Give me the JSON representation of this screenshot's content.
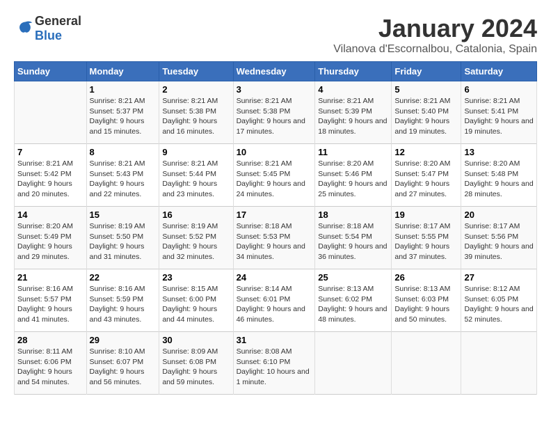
{
  "header": {
    "title": "January 2024",
    "subtitle": "Vilanova d'Escornalbou, Catalonia, Spain"
  },
  "logo": {
    "general": "General",
    "blue": "Blue"
  },
  "columns": [
    "Sunday",
    "Monday",
    "Tuesday",
    "Wednesday",
    "Thursday",
    "Friday",
    "Saturday"
  ],
  "weeks": [
    [
      {
        "day": "",
        "sunrise": "",
        "sunset": "",
        "daylight": ""
      },
      {
        "day": "1",
        "sunrise": "Sunrise: 8:21 AM",
        "sunset": "Sunset: 5:37 PM",
        "daylight": "Daylight: 9 hours and 15 minutes."
      },
      {
        "day": "2",
        "sunrise": "Sunrise: 8:21 AM",
        "sunset": "Sunset: 5:38 PM",
        "daylight": "Daylight: 9 hours and 16 minutes."
      },
      {
        "day": "3",
        "sunrise": "Sunrise: 8:21 AM",
        "sunset": "Sunset: 5:38 PM",
        "daylight": "Daylight: 9 hours and 17 minutes."
      },
      {
        "day": "4",
        "sunrise": "Sunrise: 8:21 AM",
        "sunset": "Sunset: 5:39 PM",
        "daylight": "Daylight: 9 hours and 18 minutes."
      },
      {
        "day": "5",
        "sunrise": "Sunrise: 8:21 AM",
        "sunset": "Sunset: 5:40 PM",
        "daylight": "Daylight: 9 hours and 19 minutes."
      },
      {
        "day": "6",
        "sunrise": "Sunrise: 8:21 AM",
        "sunset": "Sunset: 5:41 PM",
        "daylight": "Daylight: 9 hours and 19 minutes."
      }
    ],
    [
      {
        "day": "7",
        "sunrise": "Sunrise: 8:21 AM",
        "sunset": "Sunset: 5:42 PM",
        "daylight": "Daylight: 9 hours and 20 minutes."
      },
      {
        "day": "8",
        "sunrise": "Sunrise: 8:21 AM",
        "sunset": "Sunset: 5:43 PM",
        "daylight": "Daylight: 9 hours and 22 minutes."
      },
      {
        "day": "9",
        "sunrise": "Sunrise: 8:21 AM",
        "sunset": "Sunset: 5:44 PM",
        "daylight": "Daylight: 9 hours and 23 minutes."
      },
      {
        "day": "10",
        "sunrise": "Sunrise: 8:21 AM",
        "sunset": "Sunset: 5:45 PM",
        "daylight": "Daylight: 9 hours and 24 minutes."
      },
      {
        "day": "11",
        "sunrise": "Sunrise: 8:20 AM",
        "sunset": "Sunset: 5:46 PM",
        "daylight": "Daylight: 9 hours and 25 minutes."
      },
      {
        "day": "12",
        "sunrise": "Sunrise: 8:20 AM",
        "sunset": "Sunset: 5:47 PM",
        "daylight": "Daylight: 9 hours and 27 minutes."
      },
      {
        "day": "13",
        "sunrise": "Sunrise: 8:20 AM",
        "sunset": "Sunset: 5:48 PM",
        "daylight": "Daylight: 9 hours and 28 minutes."
      }
    ],
    [
      {
        "day": "14",
        "sunrise": "Sunrise: 8:20 AM",
        "sunset": "Sunset: 5:49 PM",
        "daylight": "Daylight: 9 hours and 29 minutes."
      },
      {
        "day": "15",
        "sunrise": "Sunrise: 8:19 AM",
        "sunset": "Sunset: 5:50 PM",
        "daylight": "Daylight: 9 hours and 31 minutes."
      },
      {
        "day": "16",
        "sunrise": "Sunrise: 8:19 AM",
        "sunset": "Sunset: 5:52 PM",
        "daylight": "Daylight: 9 hours and 32 minutes."
      },
      {
        "day": "17",
        "sunrise": "Sunrise: 8:18 AM",
        "sunset": "Sunset: 5:53 PM",
        "daylight": "Daylight: 9 hours and 34 minutes."
      },
      {
        "day": "18",
        "sunrise": "Sunrise: 8:18 AM",
        "sunset": "Sunset: 5:54 PM",
        "daylight": "Daylight: 9 hours and 36 minutes."
      },
      {
        "day": "19",
        "sunrise": "Sunrise: 8:17 AM",
        "sunset": "Sunset: 5:55 PM",
        "daylight": "Daylight: 9 hours and 37 minutes."
      },
      {
        "day": "20",
        "sunrise": "Sunrise: 8:17 AM",
        "sunset": "Sunset: 5:56 PM",
        "daylight": "Daylight: 9 hours and 39 minutes."
      }
    ],
    [
      {
        "day": "21",
        "sunrise": "Sunrise: 8:16 AM",
        "sunset": "Sunset: 5:57 PM",
        "daylight": "Daylight: 9 hours and 41 minutes."
      },
      {
        "day": "22",
        "sunrise": "Sunrise: 8:16 AM",
        "sunset": "Sunset: 5:59 PM",
        "daylight": "Daylight: 9 hours and 43 minutes."
      },
      {
        "day": "23",
        "sunrise": "Sunrise: 8:15 AM",
        "sunset": "Sunset: 6:00 PM",
        "daylight": "Daylight: 9 hours and 44 minutes."
      },
      {
        "day": "24",
        "sunrise": "Sunrise: 8:14 AM",
        "sunset": "Sunset: 6:01 PM",
        "daylight": "Daylight: 9 hours and 46 minutes."
      },
      {
        "day": "25",
        "sunrise": "Sunrise: 8:13 AM",
        "sunset": "Sunset: 6:02 PM",
        "daylight": "Daylight: 9 hours and 48 minutes."
      },
      {
        "day": "26",
        "sunrise": "Sunrise: 8:13 AM",
        "sunset": "Sunset: 6:03 PM",
        "daylight": "Daylight: 9 hours and 50 minutes."
      },
      {
        "day": "27",
        "sunrise": "Sunrise: 8:12 AM",
        "sunset": "Sunset: 6:05 PM",
        "daylight": "Daylight: 9 hours and 52 minutes."
      }
    ],
    [
      {
        "day": "28",
        "sunrise": "Sunrise: 8:11 AM",
        "sunset": "Sunset: 6:06 PM",
        "daylight": "Daylight: 9 hours and 54 minutes."
      },
      {
        "day": "29",
        "sunrise": "Sunrise: 8:10 AM",
        "sunset": "Sunset: 6:07 PM",
        "daylight": "Daylight: 9 hours and 56 minutes."
      },
      {
        "day": "30",
        "sunrise": "Sunrise: 8:09 AM",
        "sunset": "Sunset: 6:08 PM",
        "daylight": "Daylight: 9 hours and 59 minutes."
      },
      {
        "day": "31",
        "sunrise": "Sunrise: 8:08 AM",
        "sunset": "Sunset: 6:10 PM",
        "daylight": "Daylight: 10 hours and 1 minute."
      },
      {
        "day": "",
        "sunrise": "",
        "sunset": "",
        "daylight": ""
      },
      {
        "day": "",
        "sunrise": "",
        "sunset": "",
        "daylight": ""
      },
      {
        "day": "",
        "sunrise": "",
        "sunset": "",
        "daylight": ""
      }
    ]
  ]
}
